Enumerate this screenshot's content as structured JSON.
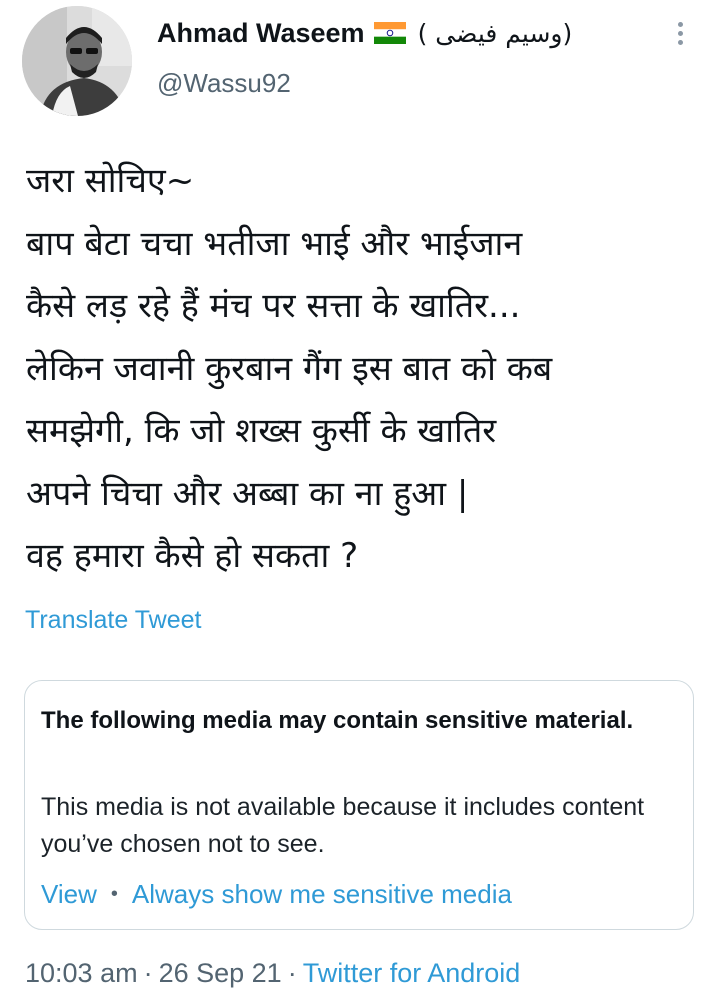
{
  "author": {
    "display_name": "Ahmad Waseem",
    "display_name_suffix": "( وسیم فیضی)",
    "handle": "@Wassu92",
    "flag_icon": "india-flag-icon",
    "avatar_icon": "profile-photo"
  },
  "menu": {
    "icon": "vertical-ellipsis-icon"
  },
  "tweet": {
    "lines": [
      "जरा सोचिए~",
      "बाप बेटा चचा भतीजा भाई और भाईजान",
      "कैसे लड़ रहे हैं मंच पर सत्ता के खातिर...",
      "लेकिन जवानी कुरबान गैंग इस बात को कब",
      "समझेगी, कि जो शख्स कुर्सी के खातिर",
      "अपने चिचा और अब्बा का ना हुआ |",
      "वह हमारा कैसे हो सकता ?"
    ],
    "translate_label": "Translate Tweet"
  },
  "sensitive_media": {
    "title": "The following media may contain sensitive material.",
    "body": "This media is not available because it includes content you’ve chosen not to see.",
    "view_label": "View",
    "separator": "•",
    "always_show_label": "Always show me sensitive media"
  },
  "meta": {
    "time": "10:03 am",
    "separator": "·",
    "date": "26 Sep 21",
    "source": "Twitter for Android"
  },
  "colors": {
    "link": "#2f9ad6",
    "secondary_text": "#536471",
    "card_border": "#cfd9de",
    "flag_saffron": "#ff9933",
    "flag_green": "#138808",
    "flag_chakra": "#000080"
  }
}
